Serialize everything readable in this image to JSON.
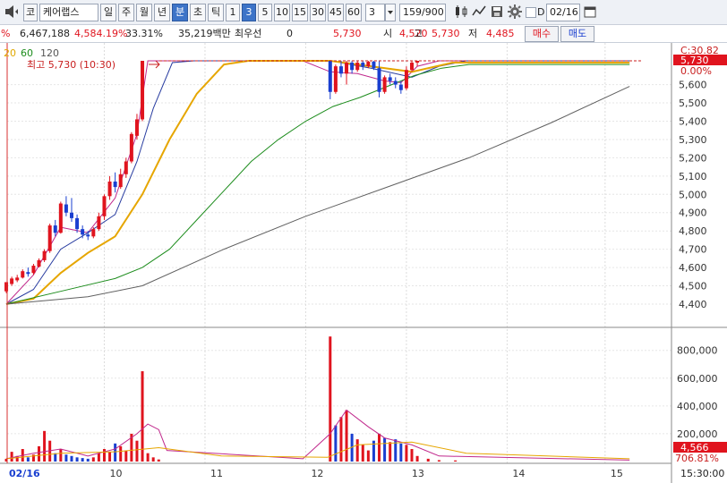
{
  "toolbar": {
    "nav_icon": "speaker-icon",
    "market_type": "코",
    "stock_name": "케어랩스",
    "periods": [
      "일",
      "주",
      "월",
      "년",
      "분",
      "초",
      "틱"
    ],
    "active_period": "분",
    "intervals": [
      "1",
      "3",
      "5",
      "10",
      "15",
      "30",
      "45",
      "60"
    ],
    "active_interval": "3",
    "interval_value": "3",
    "count_value": "159/900",
    "date_value": "02/16",
    "checkbox_label": "D"
  },
  "infobar": {
    "volume": "6,467,188",
    "volume_ratio": "4,584.19%",
    "turnover": "33.31%",
    "amount": "35,219백만",
    "top_priority_label": "최우선",
    "top_priority_value": "0",
    "current_price": "5,730",
    "open_label": "시",
    "open_value": "4,520",
    "high_label": "고",
    "high_value": "5,730",
    "low_label": "저",
    "low_value": "4,485",
    "buy_label": "매수",
    "sell_label": "매도"
  },
  "legend": {
    "ma_periods": [
      "20",
      "60",
      "120"
    ],
    "ma_colors": [
      "#e0a800",
      "#1c8c1c",
      "#555555"
    ]
  },
  "annotation": {
    "high_label": "최고 5,730 (10:30)"
  },
  "right_panel": {
    "top_tag": "C:30.82",
    "current_price_tag": "5,730",
    "change_tag": "0.00%",
    "volume_tag": "4,566",
    "volume_change_tag": "706.81%",
    "time_tag": "15:30:00"
  },
  "colors": {
    "up": "#e0141e",
    "down": "#1a3fd0",
    "ma5": "#c0288c",
    "ma10": "#283ca0",
    "ma20": "#e6a600",
    "ma60": "#1c8c1c",
    "ma120": "#606060"
  },
  "chart_data": {
    "type": "candlestick",
    "price_axis": {
      "ticks": [
        4400,
        4500,
        4600,
        4700,
        4800,
        4900,
        5000,
        5100,
        5200,
        5300,
        5400,
        5500,
        5600
      ]
    },
    "volume_axis": {
      "ticks": [
        200000,
        400000,
        600000,
        800000
      ]
    },
    "x_labels": [
      "02/16",
      "10",
      "11",
      "12",
      "13",
      "14",
      "15"
    ],
    "candles": [
      {
        "t": 1,
        "o": 4470,
        "h": 4520,
        "l": 4460,
        "c": 4520
      },
      {
        "t": 3,
        "o": 4510,
        "h": 4550,
        "l": 4500,
        "c": 4540
      },
      {
        "t": 5,
        "o": 4530,
        "h": 4560,
        "l": 4520,
        "c": 4545
      },
      {
        "t": 7,
        "o": 4545,
        "h": 4590,
        "l": 4540,
        "c": 4580
      },
      {
        "t": 9,
        "o": 4575,
        "h": 4600,
        "l": 4550,
        "c": 4565
      },
      {
        "t": 11,
        "o": 4570,
        "h": 4620,
        "l": 4560,
        "c": 4610
      },
      {
        "t": 13,
        "o": 4605,
        "h": 4650,
        "l": 4600,
        "c": 4640
      },
      {
        "t": 15,
        "o": 4640,
        "h": 4700,
        "l": 4630,
        "c": 4690
      },
      {
        "t": 17,
        "o": 4690,
        "h": 4840,
        "l": 4680,
        "c": 4830
      },
      {
        "t": 19,
        "o": 4830,
        "h": 4860,
        "l": 4770,
        "c": 4790
      },
      {
        "t": 21,
        "o": 4790,
        "h": 4960,
        "l": 4785,
        "c": 4950
      },
      {
        "t": 23,
        "o": 4945,
        "h": 4990,
        "l": 4880,
        "c": 4900
      },
      {
        "t": 25,
        "o": 4900,
        "h": 4980,
        "l": 4850,
        "c": 4870
      },
      {
        "t": 27,
        "o": 4870,
        "h": 4890,
        "l": 4790,
        "c": 4810
      },
      {
        "t": 29,
        "o": 4810,
        "h": 4830,
        "l": 4760,
        "c": 4780
      },
      {
        "t": 31,
        "o": 4780,
        "h": 4800,
        "l": 4750,
        "c": 4770
      },
      {
        "t": 33,
        "o": 4770,
        "h": 4820,
        "l": 4760,
        "c": 4810
      },
      {
        "t": 35,
        "o": 4810,
        "h": 4900,
        "l": 4800,
        "c": 4880
      },
      {
        "t": 37,
        "o": 4880,
        "h": 5000,
        "l": 4860,
        "c": 4990
      },
      {
        "t": 39,
        "o": 4990,
        "h": 5100,
        "l": 4970,
        "c": 5070
      },
      {
        "t": 41,
        "o": 5070,
        "h": 5120,
        "l": 5010,
        "c": 5040
      },
      {
        "t": 43,
        "o": 5040,
        "h": 5140,
        "l": 5030,
        "c": 5110
      },
      {
        "t": 45,
        "o": 5110,
        "h": 5200,
        "l": 5090,
        "c": 5180
      },
      {
        "t": 47,
        "o": 5180,
        "h": 5340,
        "l": 5170,
        "c": 5330
      },
      {
        "t": 49,
        "o": 5320,
        "h": 5440,
        "l": 5300,
        "c": 5410
      },
      {
        "t": 51,
        "o": 5410,
        "h": 5730,
        "l": 5400,
        "c": 5730
      },
      {
        "t": 120,
        "o": 5730,
        "h": 5730,
        "l": 5520,
        "c": 5560
      },
      {
        "t": 122,
        "o": 5560,
        "h": 5710,
        "l": 5550,
        "c": 5700
      },
      {
        "t": 124,
        "o": 5700,
        "h": 5730,
        "l": 5640,
        "c": 5660
      },
      {
        "t": 126,
        "o": 5660,
        "h": 5730,
        "l": 5600,
        "c": 5720
      },
      {
        "t": 128,
        "o": 5720,
        "h": 5730,
        "l": 5660,
        "c": 5680
      },
      {
        "t": 130,
        "o": 5680,
        "h": 5730,
        "l": 5670,
        "c": 5720
      },
      {
        "t": 132,
        "o": 5720,
        "h": 5730,
        "l": 5680,
        "c": 5700
      },
      {
        "t": 134,
        "o": 5700,
        "h": 5730,
        "l": 5690,
        "c": 5725
      },
      {
        "t": 136,
        "o": 5725,
        "h": 5730,
        "l": 5680,
        "c": 5690
      },
      {
        "t": 138,
        "o": 5690,
        "h": 5730,
        "l": 5530,
        "c": 5560
      },
      {
        "t": 140,
        "o": 5560,
        "h": 5650,
        "l": 5550,
        "c": 5640
      },
      {
        "t": 142,
        "o": 5640,
        "h": 5660,
        "l": 5600,
        "c": 5620
      },
      {
        "t": 144,
        "o": 5620,
        "h": 5640,
        "l": 5580,
        "c": 5600
      },
      {
        "t": 146,
        "o": 5600,
        "h": 5620,
        "l": 5550,
        "c": 5570
      },
      {
        "t": 148,
        "o": 5580,
        "h": 5700,
        "l": 5570,
        "c": 5680
      },
      {
        "t": 150,
        "o": 5680,
        "h": 5730,
        "l": 5670,
        "c": 5720
      },
      {
        "t": 152,
        "o": 5720,
        "h": 5730,
        "l": 5700,
        "c": 5730
      }
    ],
    "volumes": [
      {
        "t": 1,
        "v": 20000,
        "up": true
      },
      {
        "t": 3,
        "v": 70000,
        "up": true
      },
      {
        "t": 5,
        "v": 40000,
        "up": true
      },
      {
        "t": 7,
        "v": 90000,
        "up": true
      },
      {
        "t": 9,
        "v": 30000,
        "up": false
      },
      {
        "t": 11,
        "v": 50000,
        "up": true
      },
      {
        "t": 13,
        "v": 110000,
        "up": true
      },
      {
        "t": 15,
        "v": 220000,
        "up": true
      },
      {
        "t": 17,
        "v": 150000,
        "up": true
      },
      {
        "t": 19,
        "v": 60000,
        "up": false
      },
      {
        "t": 21,
        "v": 90000,
        "up": true
      },
      {
        "t": 23,
        "v": 50000,
        "up": false
      },
      {
        "t": 25,
        "v": 40000,
        "up": false
      },
      {
        "t": 27,
        "v": 30000,
        "up": false
      },
      {
        "t": 29,
        "v": 25000,
        "up": false
      },
      {
        "t": 31,
        "v": 20000,
        "up": false
      },
      {
        "t": 33,
        "v": 30000,
        "up": true
      },
      {
        "t": 35,
        "v": 60000,
        "up": true
      },
      {
        "t": 37,
        "v": 90000,
        "up": true
      },
      {
        "t": 39,
        "v": 70000,
        "up": true
      },
      {
        "t": 41,
        "v": 130000,
        "up": false
      },
      {
        "t": 43,
        "v": 110000,
        "up": true
      },
      {
        "t": 45,
        "v": 80000,
        "up": true
      },
      {
        "t": 47,
        "v": 200000,
        "up": true
      },
      {
        "t": 49,
        "v": 150000,
        "up": true
      },
      {
        "t": 51,
        "v": 650000,
        "up": true
      },
      {
        "t": 53,
        "v": 60000,
        "up": true
      },
      {
        "t": 55,
        "v": 30000,
        "up": true
      },
      {
        "t": 57,
        "v": 15000,
        "up": true
      },
      {
        "t": 120,
        "v": 900000,
        "up": true
      },
      {
        "t": 122,
        "v": 260000,
        "up": false
      },
      {
        "t": 124,
        "v": 320000,
        "up": true
      },
      {
        "t": 126,
        "v": 370000,
        "up": true
      },
      {
        "t": 128,
        "v": 200000,
        "up": false
      },
      {
        "t": 130,
        "v": 160000,
        "up": true
      },
      {
        "t": 132,
        "v": 120000,
        "up": true
      },
      {
        "t": 134,
        "v": 80000,
        "up": true
      },
      {
        "t": 136,
        "v": 150000,
        "up": false
      },
      {
        "t": 138,
        "v": 200000,
        "up": true
      },
      {
        "t": 140,
        "v": 170000,
        "up": false
      },
      {
        "t": 142,
        "v": 140000,
        "up": true
      },
      {
        "t": 144,
        "v": 160000,
        "up": false
      },
      {
        "t": 146,
        "v": 130000,
        "up": false
      },
      {
        "t": 148,
        "v": 120000,
        "up": true
      },
      {
        "t": 150,
        "v": 90000,
        "up": true
      },
      {
        "t": 152,
        "v": 40000,
        "up": true
      },
      {
        "t": 156,
        "v": 20000,
        "up": true
      },
      {
        "t": 160,
        "v": 10000,
        "up": true
      },
      {
        "t": 166,
        "v": 8000,
        "up": true
      }
    ],
    "ma_lines": [
      {
        "name": "ma5",
        "points": [
          [
            1,
            4400
          ],
          [
            11,
            4560
          ],
          [
            21,
            4820
          ],
          [
            31,
            4790
          ],
          [
            41,
            4980
          ],
          [
            49,
            5330
          ],
          [
            53,
            5730
          ],
          [
            60,
            5730
          ],
          [
            110,
            5730
          ],
          [
            120,
            5670
          ],
          [
            130,
            5660
          ],
          [
            140,
            5620
          ],
          [
            146,
            5610
          ],
          [
            152,
            5700
          ],
          [
            160,
            5730
          ],
          [
            230,
            5730
          ]
        ]
      },
      {
        "name": "ma10",
        "points": [
          [
            1,
            4400
          ],
          [
            11,
            4480
          ],
          [
            21,
            4700
          ],
          [
            31,
            4790
          ],
          [
            41,
            4890
          ],
          [
            49,
            5180
          ],
          [
            55,
            5470
          ],
          [
            62,
            5720
          ],
          [
            70,
            5730
          ],
          [
            120,
            5730
          ],
          [
            135,
            5690
          ],
          [
            150,
            5640
          ],
          [
            160,
            5700
          ],
          [
            170,
            5730
          ],
          [
            230,
            5730
          ]
        ]
      },
      {
        "name": "ma20",
        "points": [
          [
            1,
            4400
          ],
          [
            11,
            4430
          ],
          [
            21,
            4570
          ],
          [
            31,
            4680
          ],
          [
            41,
            4770
          ],
          [
            51,
            5000
          ],
          [
            61,
            5300
          ],
          [
            71,
            5550
          ],
          [
            81,
            5710
          ],
          [
            90,
            5730
          ],
          [
            120,
            5730
          ],
          [
            135,
            5700
          ],
          [
            150,
            5670
          ],
          [
            165,
            5720
          ],
          [
            230,
            5720
          ]
        ]
      },
      {
        "name": "ma60",
        "points": [
          [
            1,
            4400
          ],
          [
            21,
            4470
          ],
          [
            41,
            4540
          ],
          [
            51,
            4600
          ],
          [
            61,
            4700
          ],
          [
            71,
            4860
          ],
          [
            81,
            5020
          ],
          [
            91,
            5180
          ],
          [
            101,
            5300
          ],
          [
            111,
            5400
          ],
          [
            121,
            5480
          ],
          [
            131,
            5530
          ],
          [
            141,
            5590
          ],
          [
            151,
            5650
          ],
          [
            161,
            5690
          ],
          [
            171,
            5710
          ],
          [
            230,
            5710
          ]
        ]
      },
      {
        "name": "ma120",
        "points": [
          [
            1,
            4400
          ],
          [
            31,
            4440
          ],
          [
            51,
            4500
          ],
          [
            81,
            4700
          ],
          [
            111,
            4880
          ],
          [
            141,
            5040
          ],
          [
            171,
            5200
          ],
          [
            201,
            5390
          ],
          [
            230,
            5590
          ]
        ]
      }
    ],
    "volume_ma_lines": [
      {
        "name": "vma5",
        "points": [
          [
            1,
            20000
          ],
          [
            11,
            60000
          ],
          [
            21,
            90000
          ],
          [
            31,
            40000
          ],
          [
            41,
            90000
          ],
          [
            49,
            200000
          ],
          [
            53,
            270000
          ],
          [
            57,
            230000
          ],
          [
            60,
            80000
          ],
          [
            110,
            20000
          ],
          [
            120,
            200000
          ],
          [
            126,
            370000
          ],
          [
            134,
            250000
          ],
          [
            140,
            170000
          ],
          [
            150,
            120000
          ],
          [
            160,
            40000
          ],
          [
            230,
            10000
          ]
        ]
      },
      {
        "name": "vma20",
        "points": [
          [
            1,
            20000
          ],
          [
            21,
            60000
          ],
          [
            41,
            70000
          ],
          [
            57,
            100000
          ],
          [
            80,
            40000
          ],
          [
            119,
            30000
          ],
          [
            130,
            120000
          ],
          [
            150,
            140000
          ],
          [
            170,
            60000
          ],
          [
            230,
            20000
          ]
        ]
      }
    ]
  }
}
